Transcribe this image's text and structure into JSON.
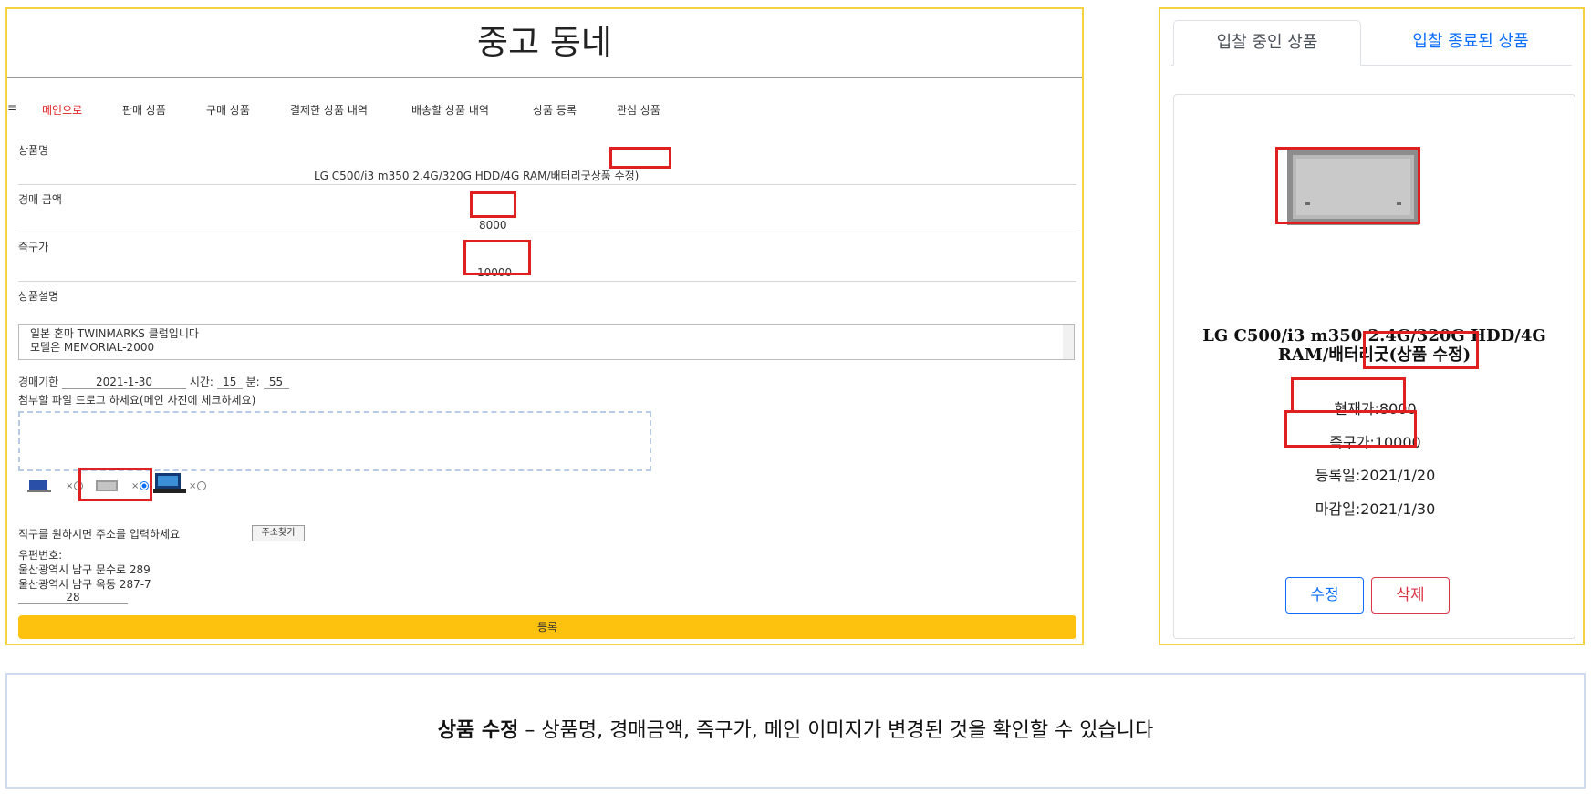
{
  "left": {
    "site_title": "중고 동네",
    "nav": {
      "menu_icon": "≡",
      "items": [
        "메인으로",
        "판매 상품",
        "구매 상품",
        "결제한 상품 내역",
        "배송할 상품 내역",
        "상품 등록",
        "관심 상품"
      ],
      "active_color": "#e02020"
    },
    "form": {
      "name_label": "상품명",
      "name_value": "LG C500/i3 m350 2.4G/320G HDD/4G RAM/배터리굿",
      "name_edit_suffix": "상품 수정)",
      "price_label": "경매 금액",
      "price_value": "8000",
      "buynow_label": "즉구가",
      "buynow_value": "10000",
      "desc_label": "상품설명",
      "desc_lines": [
        "일본 혼마 TWINMARKS 클럽입니다",
        "모델은 MEMORIAL-2000"
      ],
      "deadline_label": "경매기한",
      "deadline_value": "2021-1-30",
      "hour_label": "시간:",
      "hour_value": "15",
      "min_label": "분:",
      "min_value": "55",
      "attach_label": "첨부할 파일 드로그 하세요(메인 사진에 체크하세요)",
      "thumb_remove": "×",
      "direct_label": "직구를 원하시면 주소를 입력하세요",
      "find_addr_button": "주소찾기",
      "zip_label": "우편번호:",
      "address1": "울산광역시 남구 문수로 289",
      "address2": "울산광역시 남구 옥동 287-7",
      "address_detail": "28",
      "submit_label": "등록"
    }
  },
  "right": {
    "tabs": [
      "입찰 중인 상품",
      "입찰 종료된 상품"
    ],
    "card": {
      "title": "LG C500/i3 m350 2.4G/320G HDD/4G RAM/배터리굿(상품 수정)",
      "current_price": "현재가:8000",
      "buynow_price": "즉구가:10000",
      "registered": "등록일:2021/1/20",
      "deadline": "마감일:2021/1/30",
      "edit_button": "수정",
      "delete_button": "삭제"
    }
  },
  "caption": {
    "bold": "상품 수정",
    "rest": " – 상품명, 경매금액, 즉구가, 메인 이미지가 변경된 것을 확인할 수 있습니다"
  },
  "colors": {
    "highlight": "#e02020",
    "panel_border": "#f5d340",
    "submit": "#fdc20e",
    "primary": "#0d6efd",
    "danger": "#dc3545"
  }
}
